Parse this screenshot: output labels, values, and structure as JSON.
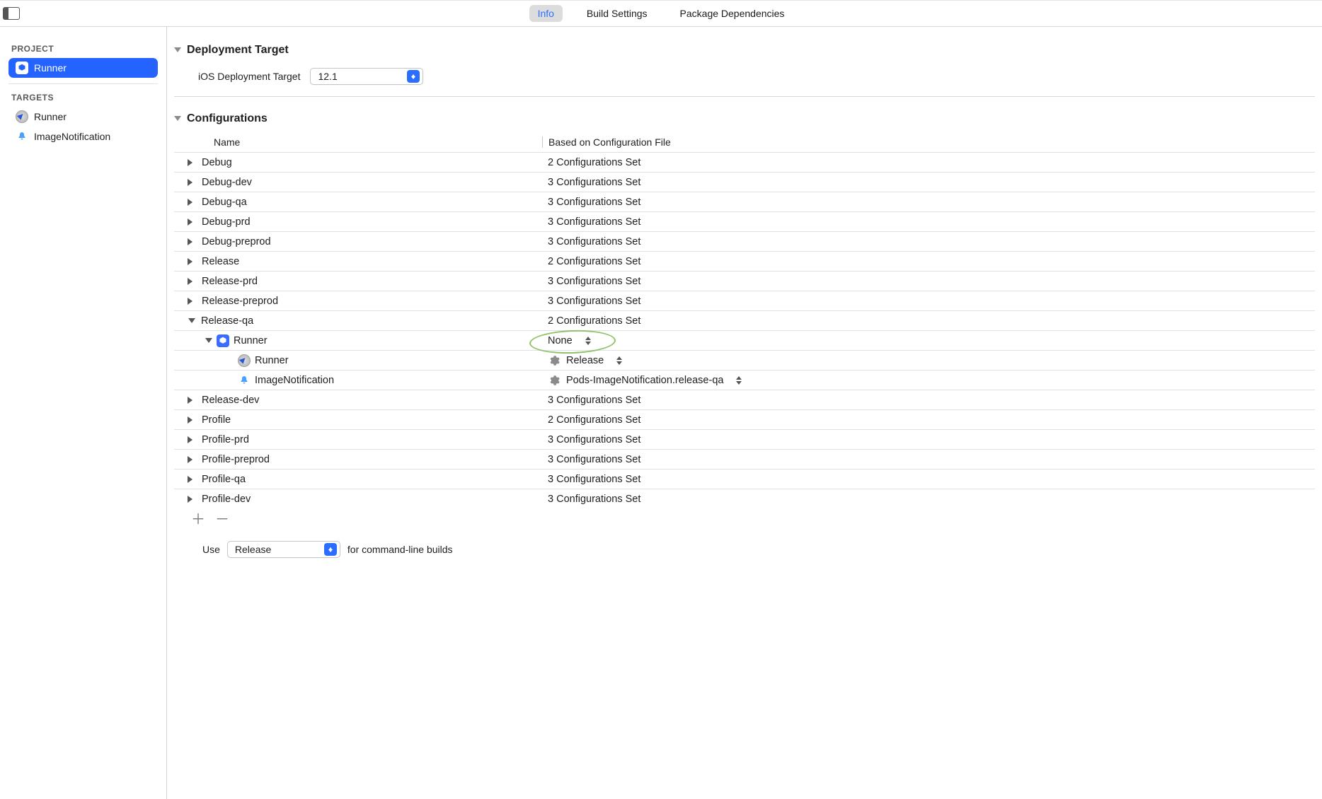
{
  "tabs": {
    "info": "Info",
    "build_settings": "Build Settings",
    "package_deps": "Package Dependencies"
  },
  "sidebar": {
    "heading_project": "PROJECT",
    "heading_targets": "TARGETS",
    "project": {
      "name": "Runner"
    },
    "targets": [
      {
        "name": "Runner",
        "icon": "compass"
      },
      {
        "name": "ImageNotification",
        "icon": "bell"
      }
    ]
  },
  "deployment": {
    "section_title": "Deployment Target",
    "field_label": "iOS Deployment Target",
    "value": "12.1"
  },
  "configurations": {
    "section_title": "Configurations",
    "col_name": "Name",
    "col_file": "Based on Configuration File",
    "rows": [
      {
        "indent": 0,
        "name": "Debug",
        "file": "2 Configurations Set",
        "expanded": false
      },
      {
        "indent": 0,
        "name": "Debug-dev",
        "file": "3 Configurations Set",
        "expanded": false
      },
      {
        "indent": 0,
        "name": "Debug-qa",
        "file": "3 Configurations Set",
        "expanded": false
      },
      {
        "indent": 0,
        "name": "Debug-prd",
        "file": "3 Configurations Set",
        "expanded": false
      },
      {
        "indent": 0,
        "name": "Debug-preprod",
        "file": "3 Configurations Set",
        "expanded": false
      },
      {
        "indent": 0,
        "name": "Release",
        "file": "2 Configurations Set",
        "expanded": false
      },
      {
        "indent": 0,
        "name": "Release-prd",
        "file": "3 Configurations Set",
        "expanded": false
      },
      {
        "indent": 0,
        "name": "Release-preprod",
        "file": "3 Configurations Set",
        "expanded": false
      },
      {
        "indent": 0,
        "name": "Release-qa",
        "file": "2 Configurations Set",
        "expanded": true
      },
      {
        "indent": 1,
        "name": "Runner",
        "icon": "app",
        "file": "None",
        "expanded": true,
        "circled": true,
        "dropdown": true
      },
      {
        "indent": 2,
        "name": "Runner",
        "icon": "compass",
        "file": "Release",
        "dropdown": true,
        "gear": true
      },
      {
        "indent": 2,
        "name": "ImageNotification",
        "icon": "bell",
        "file": "Pods-ImageNotification.release-qa",
        "dropdown": true,
        "gear": true
      },
      {
        "indent": 0,
        "name": "Release-dev",
        "file": "3 Configurations Set",
        "expanded": false
      },
      {
        "indent": 0,
        "name": "Profile",
        "file": "2 Configurations Set",
        "expanded": false
      },
      {
        "indent": 0,
        "name": "Profile-prd",
        "file": "3 Configurations Set",
        "expanded": false
      },
      {
        "indent": 0,
        "name": "Profile-preprod",
        "file": "3 Configurations Set",
        "expanded": false
      },
      {
        "indent": 0,
        "name": "Profile-qa",
        "file": "3 Configurations Set",
        "expanded": false
      },
      {
        "indent": 0,
        "name": "Profile-dev",
        "file": "3 Configurations Set",
        "expanded": false
      }
    ],
    "use_label": "Use",
    "use_value": "Release",
    "use_suffix": "for command-line builds"
  }
}
